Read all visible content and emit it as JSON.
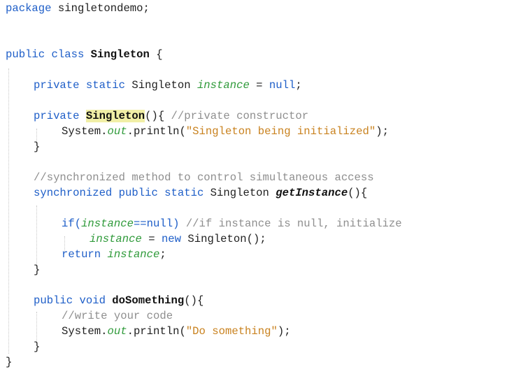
{
  "editor": {
    "colors": {
      "keyword": "#1e5ec8",
      "comment": "#8e8e8e",
      "string": "#c9821f",
      "field": "#2f9a3a",
      "text": "#1f1f1f",
      "highlight": "#f1efa6"
    },
    "lines": {
      "l01": {
        "kw": "package",
        "text": " singletondemo;"
      },
      "l03": {
        "kw_public": "public",
        "kw_class": " class",
        "sp": " ",
        "name": "Singleton",
        "rest": " {"
      },
      "l04": {
        "kw": "private static",
        "type": " Singleton ",
        "field": "instance",
        "op": " = ",
        "kw_null": "null",
        "end": ";"
      },
      "l05": {
        "kw": "private",
        "sp": " ",
        "name": "Singleton",
        "rest": "(){ ",
        "comment": "//private constructor"
      },
      "l06": {
        "call_start": "System.",
        "field": "out",
        "call_end": ".println(",
        "string": "\"Singleton being initialized\"",
        "end": ");"
      },
      "l07": {
        "brace": "}"
      },
      "l09": {
        "comment": "//synchronized method to control simultaneous access"
      },
      "l10": {
        "kw": "synchronized public static",
        "type": " Singleton ",
        "method": "getInstance",
        "rest": "(){"
      },
      "l12": {
        "kw_if": "if",
        "paren": "(",
        "field": "instance",
        "op": "==",
        "kw_null": "null",
        "close": ") ",
        "comment": "//if instance is null, initialize"
      },
      "l13": {
        "field": "instance",
        "op": " = ",
        "kw_new": "new",
        "rest": " Singleton();"
      },
      "l14": {
        "kw": "return",
        "sp": " ",
        "field": "instance",
        "end": ";"
      },
      "l15": {
        "brace": "}"
      },
      "l17": {
        "kw": "public void",
        "sp": " ",
        "name": "doSomething",
        "rest": "(){"
      },
      "l18": {
        "comment": "//write your code"
      },
      "l19": {
        "call_start": "System.",
        "field": "out",
        "call_end": ".println(",
        "string": "\"Do something\"",
        "end": ");"
      },
      "l20": {
        "brace": "}"
      },
      "l21": {
        "brace": "}"
      }
    }
  }
}
